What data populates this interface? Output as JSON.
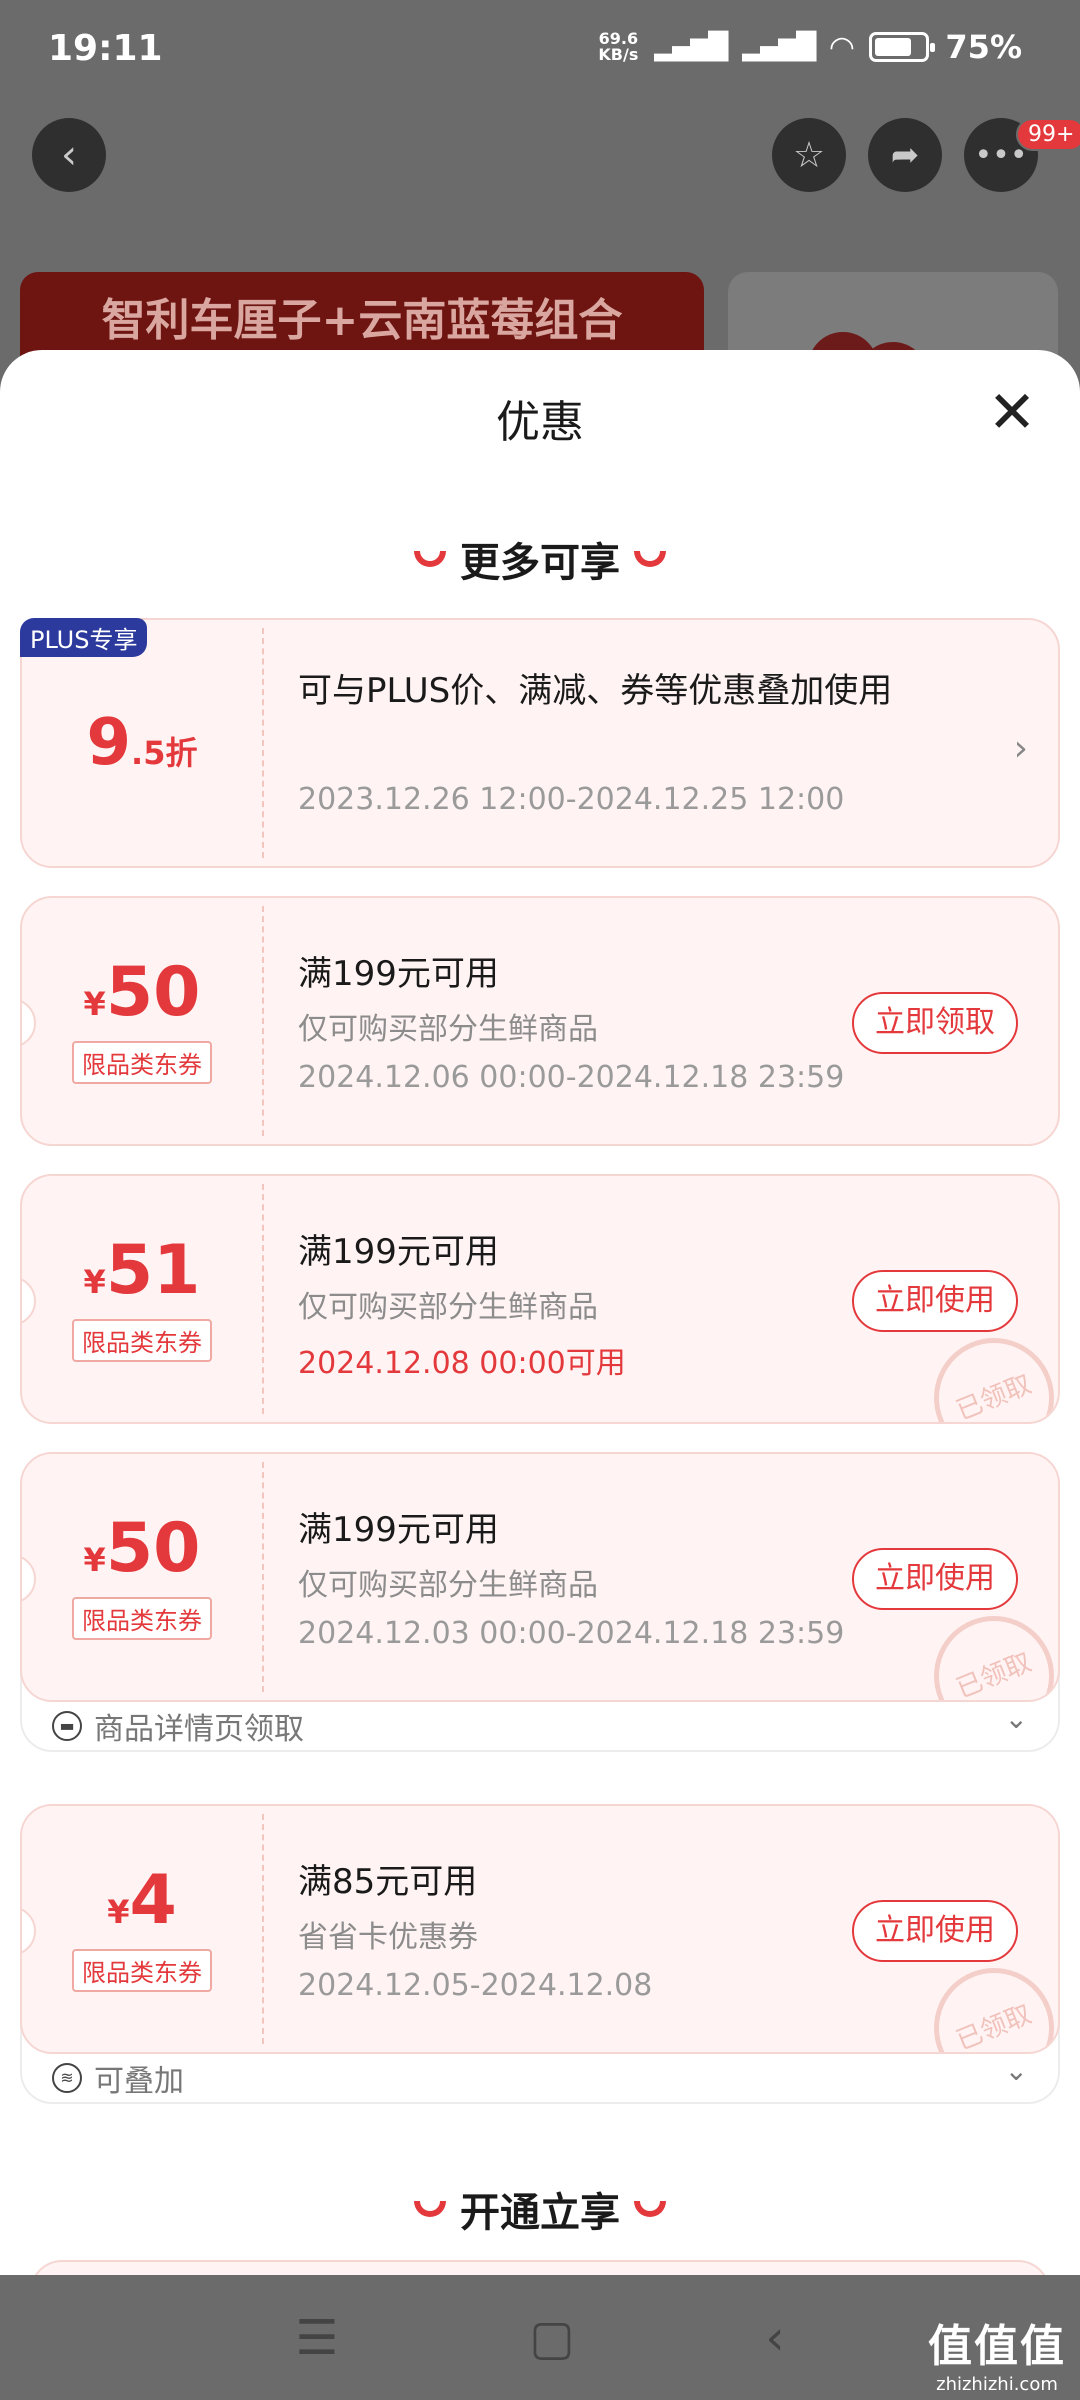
{
  "status": {
    "time": "19:11",
    "netspeed_top": "69.6",
    "netspeed_bottom": "KB/s",
    "battery": "75%",
    "battery_level": 0.75
  },
  "topbar": {
    "badge": "99+"
  },
  "background": {
    "product_title": "智利车厘子+云南蓝莓组合"
  },
  "sheet": {
    "title": "优惠",
    "section_more": "更多可享",
    "section_open": "开通立享"
  },
  "plus_coupon": {
    "badge": "PLUS专享",
    "discount_int": "9",
    "discount_dec": ".5折",
    "title": "可与PLUS价、满减、券等优惠叠加使用",
    "date": "2023.12.26 12:00-2024.12.25 12:00"
  },
  "coupons": [
    {
      "currency": "¥",
      "amount": "50",
      "tag": "限品类东券",
      "title": "满199元可用",
      "sub": "仅可购买部分生鲜商品",
      "date": "2024.12.06 00:00-2024.12.18 23:59",
      "button": "立即领取"
    },
    {
      "currency": "¥",
      "amount": "51",
      "tag": "限品类东券",
      "title": "满199元可用",
      "sub": "仅可购买部分生鲜商品",
      "date": "2024.12.08 00:00可用",
      "button": "立即使用",
      "stamp": "已领取"
    },
    {
      "currency": "¥",
      "amount": "50",
      "tag": "限品类东券",
      "title": "满199元可用",
      "sub": "仅可购买部分生鲜商品",
      "date": "2024.12.03 00:00-2024.12.18 23:59",
      "button": "立即使用",
      "stamp": "已领取",
      "footer": "商品详情页领取"
    },
    {
      "currency": "¥",
      "amount": "4",
      "tag": "限品类东券",
      "title": "满85元可用",
      "sub": "省省卡优惠券",
      "date": "2024.12.05-2024.12.08",
      "button": "立即使用",
      "stamp": "已领取",
      "footer": "可叠加"
    }
  ],
  "watermark": {
    "line1": "值值值",
    "line2": "zhizhizhi.com"
  },
  "colors": {
    "accent": "#e4393c",
    "plus": "#2c3a9e",
    "coupon_bg": "#fff4f3"
  }
}
